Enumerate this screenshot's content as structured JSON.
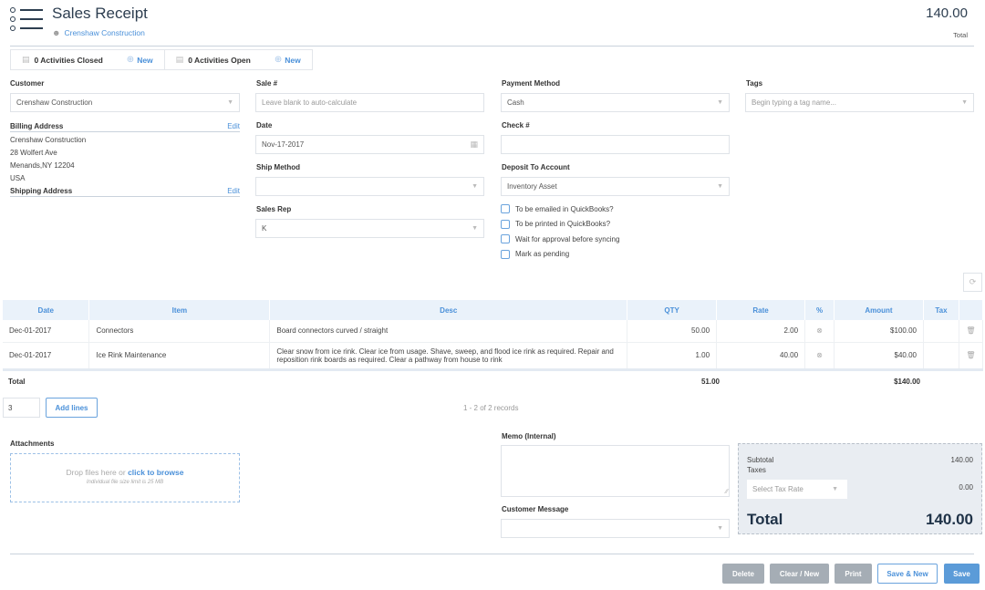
{
  "header": {
    "title": "Sales Receipt",
    "customer_link": "Crenshaw  Construction",
    "total_value": "140.00",
    "total_label": "Total"
  },
  "activities": {
    "closed_label": "0 Activities Closed",
    "open_label": "0 Activities Open",
    "new_label": "New"
  },
  "form": {
    "customer": {
      "label": "Customer",
      "value": "Crenshaw Construction"
    },
    "billing_address": {
      "label": "Billing Address",
      "edit_label": "Edit",
      "lines": [
        "Crenshaw Construction",
        "28 Wolfert Ave",
        "Menands,NY 12204",
        "USA"
      ]
    },
    "shipping_address": {
      "label": "Shipping Address",
      "edit_label": "Edit"
    },
    "sale_number": {
      "label": "Sale #",
      "placeholder": "Leave blank to auto-calculate"
    },
    "date": {
      "label": "Date",
      "value": "Nov-17-2017"
    },
    "ship_method": {
      "label": "Ship Method",
      "value": ""
    },
    "sales_rep": {
      "label": "Sales Rep",
      "value": "K"
    },
    "payment_method": {
      "label": "Payment Method",
      "value": "Cash"
    },
    "check_number": {
      "label": "Check #",
      "value": ""
    },
    "deposit_to": {
      "label": "Deposit To Account",
      "value": "Inventory Asset"
    },
    "checkboxes": [
      {
        "label": "To be emailed in QuickBooks?",
        "checked": false
      },
      {
        "label": "To be printed in QuickBooks?",
        "checked": false
      },
      {
        "label": "Wait for approval before syncing",
        "checked": false
      },
      {
        "label": "Mark as pending",
        "checked": false
      }
    ],
    "tags": {
      "label": "Tags",
      "placeholder": "Begin typing a tag name..."
    }
  },
  "table": {
    "columns": [
      "Date",
      "Item",
      "Desc",
      "QTY",
      "Rate",
      "%",
      "Amount",
      "Tax",
      ""
    ],
    "rows": [
      {
        "date": "Dec-01-2017",
        "item": "Connectors",
        "desc": "Board connectors curved / straight",
        "qty": "50.00",
        "rate": "2.00",
        "amount": "$100.00",
        "tax": ""
      },
      {
        "date": "Dec-01-2017",
        "item": "Ice Rink Maintenance",
        "desc": "Clear snow from ice rink. Clear ice from usage. Shave, sweep, and flood ice rink as required. Repair and reposition rink boards as required. Clear a pathway from house to rink",
        "qty": "1.00",
        "rate": "40.00",
        "amount": "$40.00",
        "tax": ""
      }
    ],
    "totals": {
      "label": "Total",
      "qty": "51.00",
      "amount": "$140.00"
    },
    "add_lines_count": "3",
    "add_lines_label": "Add lines",
    "records_text": "1 - 2 of 2 records"
  },
  "attachments": {
    "label": "Attachments",
    "drop_text": "Drop files here or ",
    "browse_text": "click to browse",
    "limit_text": "Individual file size limit is 25 MB"
  },
  "memo": {
    "label": "Memo (Internal)",
    "value": ""
  },
  "customer_message": {
    "label": "Customer Message",
    "value": ""
  },
  "summary": {
    "subtotal_label": "Subtotal",
    "subtotal_value": "140.00",
    "taxes_label": "Taxes",
    "tax_rate_placeholder": "Select Tax Rate",
    "taxes_value": "0.00",
    "total_label": "Total",
    "total_value": "140.00"
  },
  "buttons": {
    "delete": "Delete",
    "clear_new": "Clear / New",
    "print": "Print",
    "save_new": "Save & New",
    "save": "Save"
  }
}
